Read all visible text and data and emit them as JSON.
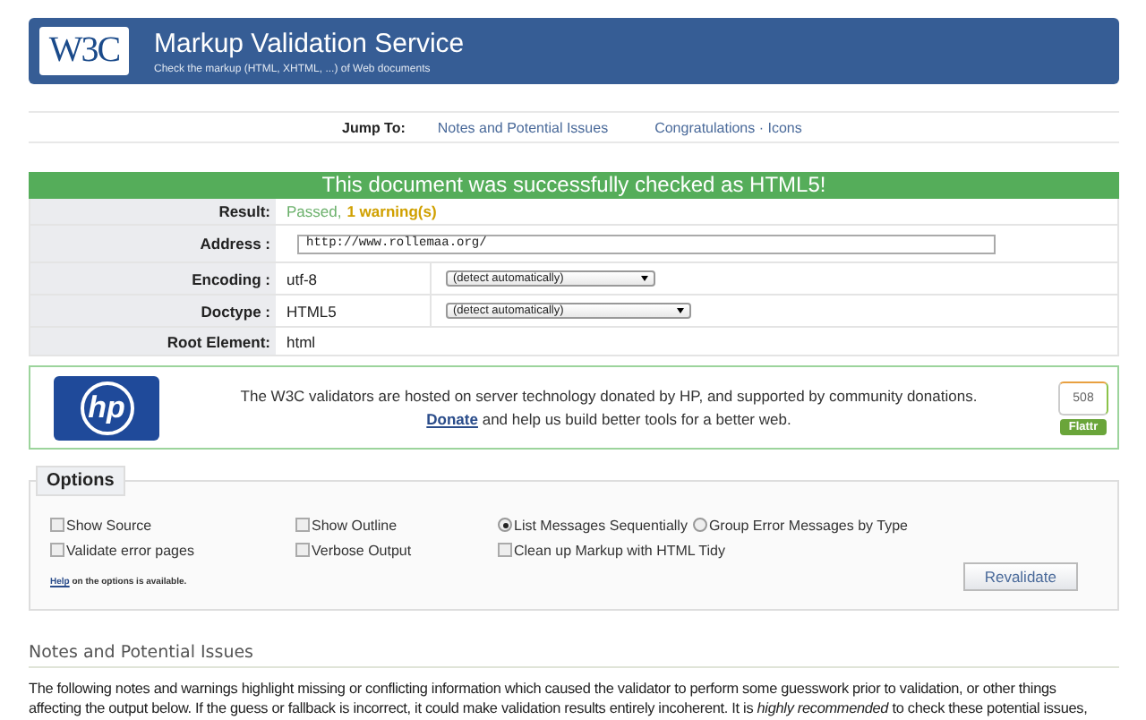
{
  "header": {
    "logo": "W3C",
    "title": "Markup Validation Service",
    "subtitle": "Check the markup (HTML, XHTML, ...) of Web documents"
  },
  "jump_to": {
    "label": "Jump To:",
    "links": [
      "Notes and Potential Issues",
      "Congratulations · Icons"
    ]
  },
  "banner": "This document was successfully checked as HTML5!",
  "result": {
    "label": "Result:",
    "passed": "Passed,",
    "warnings": "1 warning(s)"
  },
  "fields": [
    {
      "kind": "input",
      "label": "Address :",
      "value": "http://www.rollemaa.org/"
    },
    {
      "kind": "select",
      "label": "Encoding :",
      "value": "utf-8",
      "option": "(detect automatically)"
    },
    {
      "kind": "select",
      "label": "Doctype :",
      "value": "HTML5",
      "option": "(detect automatically)"
    },
    {
      "kind": "text",
      "label": "Root Element:",
      "value": "html"
    }
  ],
  "sponsor": {
    "logo": "hp",
    "message": "The W3C validators are hosted on server technology donated by HP, and supported by community donations.",
    "donate_link": "Donate",
    "donate_text": "and help us build better tools for a better web.",
    "flattr_count": "508",
    "flattr_label": "Flattr"
  },
  "options": {
    "title": "Options",
    "rows": [
      {
        "cells": [
          {
            "items": [
              {
                "kind": "checkbox",
                "label": "Show Source",
                "checked": false
              }
            ]
          },
          {
            "items": [
              {
                "kind": "checkbox",
                "label": "Show Outline",
                "checked": false
              }
            ]
          },
          {
            "items": [
              {
                "kind": "radio",
                "label": "List Messages Sequentially",
                "checked": true
              },
              {
                "kind": "radio",
                "label": "Group Error Messages by Type",
                "checked": false
              }
            ]
          }
        ]
      },
      {
        "cells": [
          {
            "items": [
              {
                "kind": "checkbox",
                "label": "Validate error pages",
                "checked": false
              }
            ]
          },
          {
            "items": [
              {
                "kind": "checkbox",
                "label": "Verbose Output",
                "checked": false
              }
            ]
          },
          {
            "items": [
              {
                "kind": "checkbox",
                "label": "Clean up Markup with HTML Tidy",
                "checked": false
              }
            ]
          }
        ]
      }
    ],
    "help_link": "Help",
    "help_text": "on the options is available.",
    "button": "Revalidate"
  },
  "notes": {
    "heading": "Notes and Potential Issues",
    "text": "The following notes and warnings highlight missing or conflicting information which caused the validator to perform some guesswork prior to validation, or other things affecting the output below. If the guess or fallback is incorrect, it could make validation results entirely incoherent. It is *highly recommended* to check these potential issues,"
  }
}
